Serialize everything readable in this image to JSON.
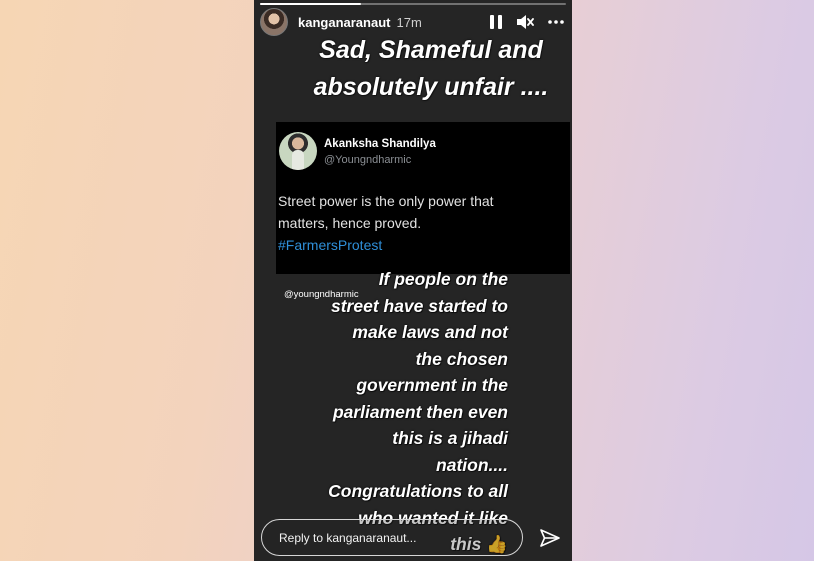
{
  "story": {
    "progress": 0.33,
    "username": "kanganaranaut",
    "time": "17m",
    "header_icons": [
      "pause-icon",
      "mute-icon",
      "more-icon"
    ],
    "headline_lines": [
      "Sad, Shameful and",
      "absolutely unfair ...."
    ],
    "tweet": {
      "name": "Akanksha Shandilya",
      "handle": "@Youngndharmic",
      "body_line1": "Street power is the only power that",
      "body_line2": "matters, hence proved.",
      "hashtag": "#FarmersProtest"
    },
    "mention_tag": "@youngndharmic",
    "caption_lines": [
      "If people on the",
      "street have started to",
      "make laws and not",
      "the chosen",
      "government in the",
      "parliament then even",
      "this is a jihadi",
      "nation....",
      "Congratulations to all",
      "who wanted it like",
      "this"
    ],
    "caption_emoji": "👍",
    "reply_placeholder": "Reply to kanganaranaut...",
    "send_icon": "send-icon"
  },
  "colors": {
    "hashtag": "#2f8fd8",
    "story_bg": "#252525",
    "tweet_bg": "#000000"
  }
}
